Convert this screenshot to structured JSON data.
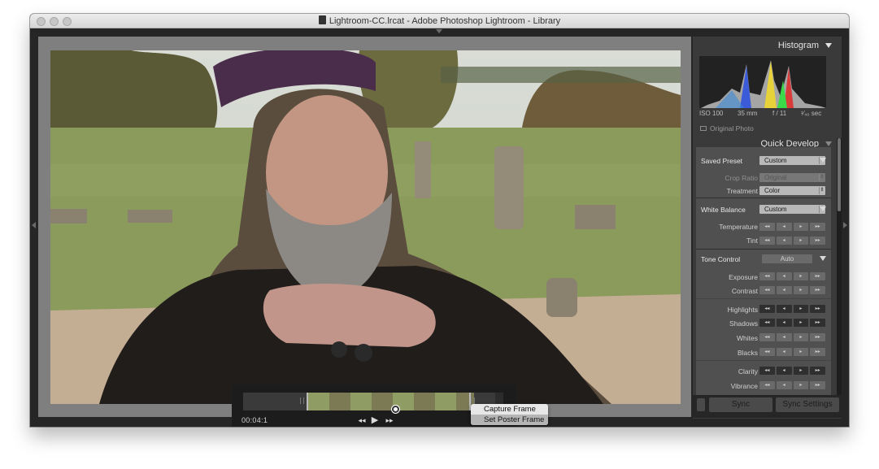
{
  "window": {
    "title": "Lightroom-CC.lrcat - Adobe Photoshop Lightroom - Library"
  },
  "video": {
    "timecode": "00:04:1",
    "menu": [
      "Capture Frame",
      "Set Poster Frame"
    ]
  },
  "histogram": {
    "title": "Histogram",
    "iso": "ISO 100",
    "focal": "35 mm",
    "aperture": "f / 11",
    "shutter": "¹⁄₄₀ sec",
    "original_photo": "Original Photo"
  },
  "quick_develop": {
    "title": "Quick Develop",
    "saved_preset_label": "Saved Preset",
    "saved_preset_value": "Custom",
    "crop_ratio_label": "Crop Ratio",
    "crop_ratio_value": "Original",
    "treatment_label": "Treatment",
    "treatment_value": "Color",
    "white_balance_label": "White Balance",
    "white_balance_value": "Custom",
    "temperature_label": "Temperature",
    "tint_label": "Tint",
    "tone_control_label": "Tone Control",
    "auto_label": "Auto",
    "exposure_label": "Exposure",
    "contrast_label": "Contrast",
    "highlights_label": "Highlights",
    "shadows_label": "Shadows",
    "whites_label": "Whites",
    "blacks_label": "Blacks",
    "clarity_label": "Clarity",
    "vibrance_label": "Vibrance"
  },
  "sync": {
    "sync_label": "Sync",
    "sync_settings_label": "Sync Settings"
  }
}
